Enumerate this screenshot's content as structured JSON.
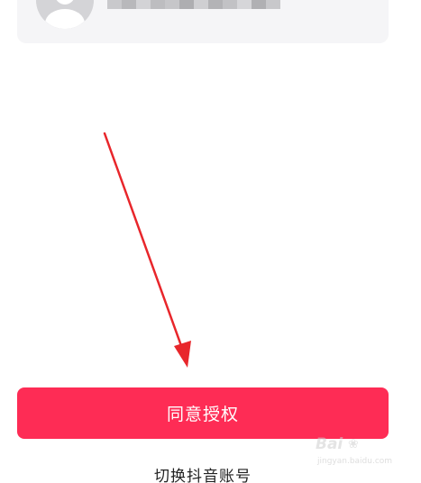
{
  "account_card": {
    "masked_name_colors": [
      "#c9c9cc",
      "#b8b8bb",
      "#d3d3d6",
      "#bdbdc0",
      "#c6c6c9",
      "#aeaeb1",
      "#cfcfd2",
      "#b3b3b6",
      "#c2c2c5",
      "#d6d6d9",
      "#b0b0b3",
      "#c8c8cb"
    ]
  },
  "annotation": {
    "arrow_color": "#e8262b",
    "icon": "arrow-pointer-icon"
  },
  "actions": {
    "agree_label": "同意授权",
    "switch_account_label": "切换抖音账号"
  },
  "colors": {
    "primary": "#fe2c55",
    "card_background": "#f5f5f7"
  },
  "watermark": {
    "logo_text": "Bai",
    "paw_glyph": "❀",
    "url_text": "jingyan.baidu.com"
  }
}
